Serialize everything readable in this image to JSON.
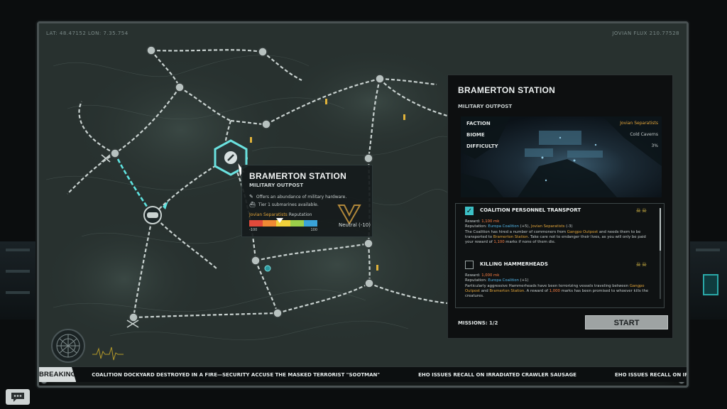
{
  "map": {
    "coord_left": "LAT: 48.47152 LON: 7.35.754",
    "coord_right": "JOVIAN FLUX 210.77528",
    "tooltip": {
      "title": "BRAMERTON STATION",
      "type": "MILITARY OUTPOST",
      "lines": [
        "Offers an abundance of military hardware.",
        "Tier 1 submarines available."
      ],
      "reputation_faction": "Jovian Separatists",
      "reputation_label": "Reputation",
      "scale_min": "-100",
      "scale_max": "100",
      "reputation_value": 0.45,
      "neutral_label": "Neutral (-10)"
    }
  },
  "station_panel": {
    "title": "BRAMERTON STATION",
    "type": "MILITARY OUTPOST",
    "info": {
      "faction_label": "FACTION",
      "faction_value": "Jovian Separatists",
      "biome_label": "BIOME",
      "biome_value": "Cold Caverns",
      "difficulty_label": "DIFFICULTY",
      "difficulty_value": "3%"
    },
    "missions": [
      {
        "title": "COALITION PERSONNEL TRANSPORT",
        "checked": true,
        "reward_label": "Reward:",
        "reward": "1,100 mk",
        "reputation_label": "Reputation:",
        "rep_faction1": "Europa Coalition",
        "rep_delta1": "(+5),",
        "rep_faction2": "Jovian Separatists",
        "rep_delta2": "(-3)",
        "desc_1": "The Coalition has hired a number of commoners from",
        "desc_2": "Gangpo Outpost",
        "desc_3": "and needs them to be transported to",
        "desc_4": "Bramerton Station",
        "desc_5": ". Take care not to endanger their lives, as you will only be paid your reward of",
        "desc_6": "1,100",
        "desc_7": "marks if none of them die."
      },
      {
        "title": "KILLING HAMMERHEADS",
        "checked": false,
        "reward_label": "Reward:",
        "reward": "1,000 mk",
        "reputation_label": "Reputation:",
        "rep_faction1": "Europa Coalition",
        "rep_delta1": "(+1)",
        "desc_1": "Particularly aggressive Hammerheads have been terrorizing vessels traveling between",
        "desc_2": "Gangpo Outpost",
        "desc_3": "and",
        "desc_4": "Bramerton Station",
        "desc_5": ". A reward of",
        "desc_6": "1,000",
        "desc_7": "marks has been promised to whoever kills the creatures."
      }
    ],
    "missions_count": "MISSIONS: 1/2",
    "start_label": "START"
  },
  "ticker": {
    "label": "BREAKING NEWS",
    "items": [
      "COALITION DOCKYARD DESTROYED IN A FIRE—SECURITY ACCUSE THE MASKED TERRORIST \"SOOTMAN\"",
      "EHO ISSUES RECALL ON IRRADIATED CRAWLER SAUSAGE",
      "EHO ISSUES RECALL ON IRRADIA"
    ]
  },
  "colors": {
    "accent": "#3cc0c6",
    "faction": "#e4a63a",
    "coalition": "#53b6e8",
    "warning": "#ff8044",
    "rep_segments": [
      "#e24a3b",
      "#f08a34",
      "#f1d13b",
      "#9bcf4a",
      "#3aa3d8"
    ]
  }
}
